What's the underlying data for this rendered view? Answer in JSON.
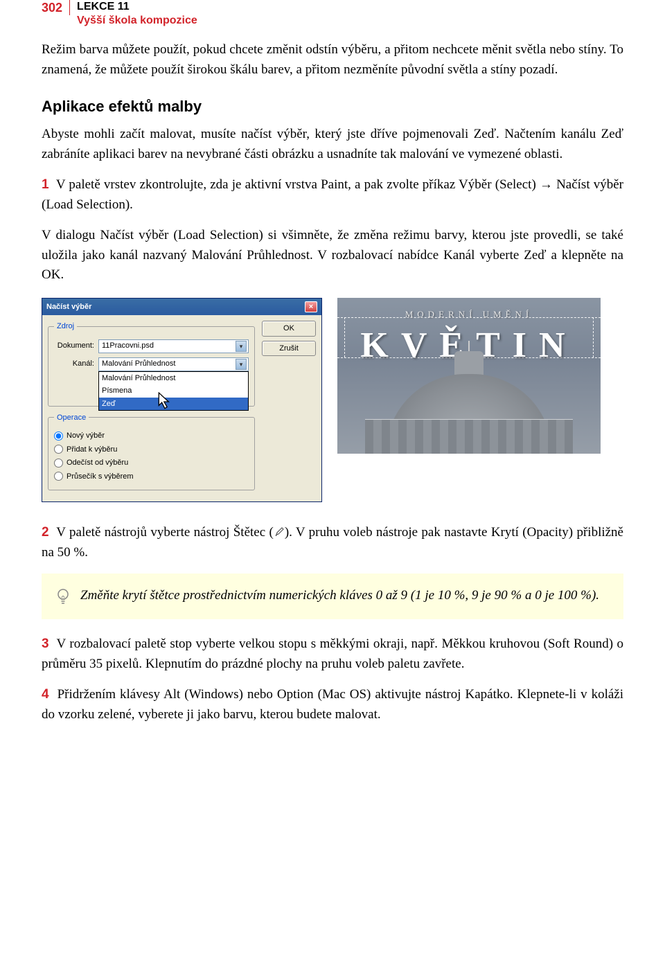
{
  "header": {
    "page": "302",
    "line1": "LEKCE 11",
    "line2": "Vyšší škola kompozice"
  },
  "intro": "Režim barva můžete použít, pokud chcete změnit odstín výběru, a přitom nechcete měnit světla nebo stíny. To znamená, že můžete použít širokou škálu barev, a přitom nezměníte původní světla a stíny pozadí.",
  "section_title": "Aplikace efektů malby",
  "p2": "Abyste mohli začít malovat, musíte načíst výběr, který jste dříve pojmenovali Zeď. Načtením kanálu Zeď zabráníte aplikaci barev na nevybrané části obrázku a usnadníte tak malování ve vymezené oblasti.",
  "step1": {
    "num": "1",
    "a": "V paletě vrstev zkontrolujte, zda je aktivní vrstva Paint, a pak zvolte příkaz Výběr (Select) → Načíst výběr (Load Selection).",
    "b": "V dialogu Načíst výběr (Load Selection) si všimněte, že změna režimu barvy, kterou jste provedli, se také uložila jako kanál nazvaný Malování Průhlednost. V rozbalovací nabídce Kanál vyberte Zeď a klepněte na OK."
  },
  "dialog": {
    "title": "Načíst výběr",
    "ok": "OK",
    "cancel": "Zrušit",
    "source_legend": "Zdroj",
    "doc_label": "Dokument:",
    "doc_value": "11Pracovni.psd",
    "chan_label": "Kanál:",
    "chan_value": "Malování Průhlednost",
    "dropdown": {
      "opt1": "Malování Průhlednost",
      "opt2": "Písmena",
      "opt3": "Zeď"
    },
    "op_legend": "Operace",
    "op1": "Nový výběr",
    "op2": "Přidat k výběru",
    "op3": "Odečíst od výběru",
    "op4": "Průsečík s výběrem"
  },
  "preview": {
    "sub": "MODERNÍ UMĚNÍ",
    "title": "KVĚTIN"
  },
  "step2": {
    "num": "2",
    "a_before": "V paletě nástrojů vyberte nástroj Štětec (",
    "a_after": "). V pruhu voleb nástroje pak nastavte Krytí (Opacity) přibližně na 50 %."
  },
  "tip": "Změňte krytí štětce prostřednictvím numerických kláves 0 až 9 (1 je 10 %, 9 je 90 % a 0 je 100 %).",
  "step3": {
    "num": "3",
    "text": "V rozbalovací paletě stop vyberte velkou stopu s měkkými okraji, např. Měkkou kruhovou (Soft Round) o průměru 35 pixelů. Klepnutím do prázdné plochy na pruhu voleb paletu zavřete."
  },
  "step4": {
    "num": "4",
    "text": "Přidržením klávesy Alt (Windows) nebo Option (Mac OS) aktivujte nástroj Kapátko. Klepnete-li v koláži do vzorku zelené, vyberete ji jako barvu, kterou budete malovat."
  }
}
